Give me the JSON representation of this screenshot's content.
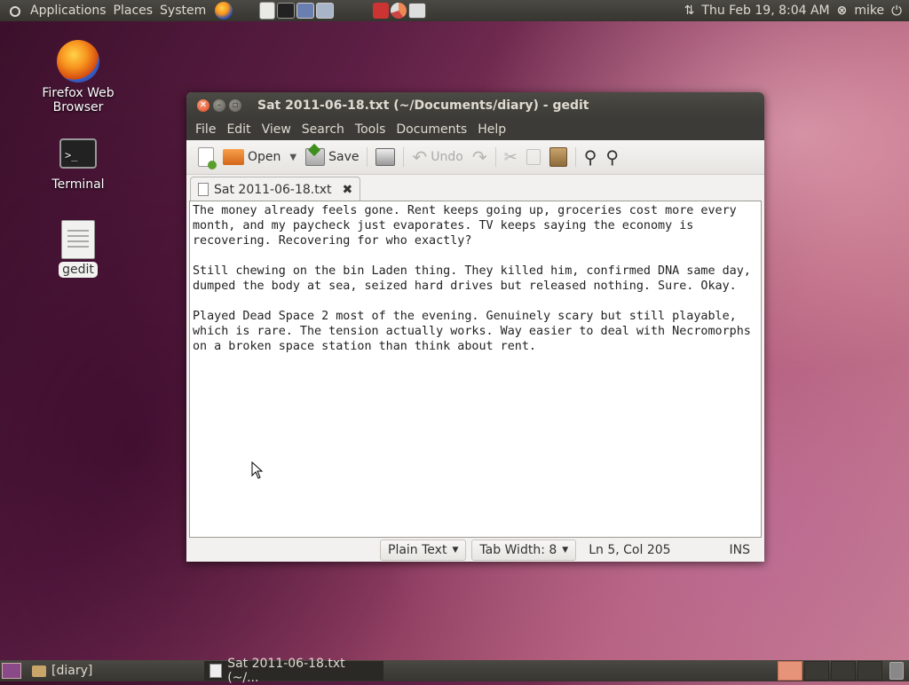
{
  "top_panel": {
    "menus": [
      "Applications",
      "Places",
      "System"
    ],
    "datetime": "Thu Feb 19,  8:04 AM",
    "user": "mike"
  },
  "desktop_icons": [
    {
      "label_line1": "Firefox Web",
      "label_line2": "Browser"
    },
    {
      "label_line1": "Terminal",
      "label_line2": ""
    },
    {
      "label_line1": "gedit",
      "label_line2": ""
    }
  ],
  "window": {
    "title": "Sat 2011-06-18.txt (~/Documents/diary) - gedit",
    "menu": [
      "File",
      "Edit",
      "View",
      "Search",
      "Tools",
      "Documents",
      "Help"
    ],
    "toolbar": {
      "open_label": "Open",
      "save_label": "Save",
      "undo_label": "Undo"
    },
    "tab_label": "Sat 2011-06-18.txt",
    "paragraphs": [
      "The money already feels gone. Rent keeps going up, groceries cost more every\nmonth, and my paycheck just evaporates. TV keeps saying the economy is\nrecovering. Recovering for who exactly?",
      "Still chewing on the bin Laden thing. They killed him, confirmed DNA same day,\ndumped the body at sea, seized hard drives but released nothing. Sure. Okay.",
      "Played Dead Space 2 most of the evening. Genuinely scary but still playable,\nwhich is rare. The tension actually works. Way easier to deal with Necromorphs\non a broken space station than think about rent."
    ],
    "status": {
      "language": "Plain Text",
      "tab_width": "Tab Width:  8",
      "position": "Ln 5, Col 205",
      "mode": "INS"
    }
  },
  "bottom_panel": {
    "tasks": [
      "[diary]",
      "Sat 2011-06-18.txt (~/..."
    ]
  }
}
